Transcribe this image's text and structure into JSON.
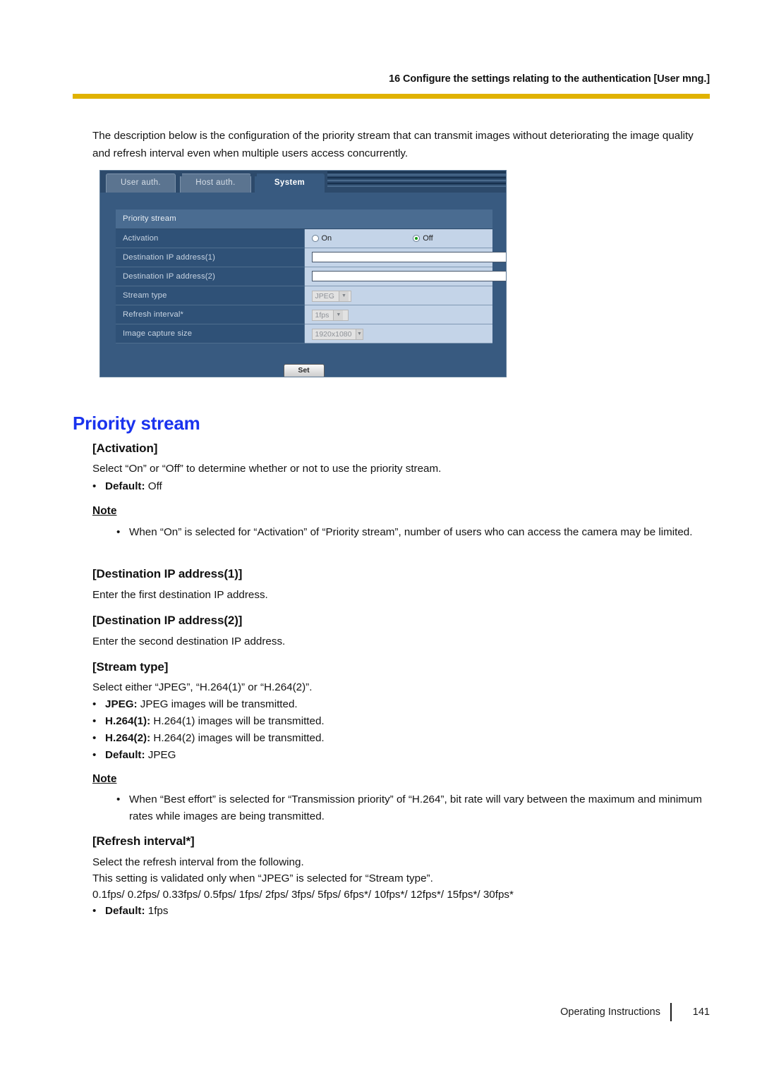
{
  "header": {
    "running_title": "16 Configure the settings relating to the authentication [User mng.]"
  },
  "intro": "The description below is the configuration of the priority stream that can transmit images without deteriorating the image quality and refresh interval even when multiple users access concurrently.",
  "screenshot": {
    "tabs": [
      {
        "label": "User auth.",
        "active": false
      },
      {
        "label": "Host auth.",
        "active": false
      },
      {
        "label": "System",
        "active": true
      }
    ],
    "section_title": "Priority stream",
    "rows": [
      {
        "label": "Activation"
      },
      {
        "label": "Destination IP address(1)"
      },
      {
        "label": "Destination IP address(2)"
      },
      {
        "label": "Stream type"
      },
      {
        "label": "Refresh interval*"
      },
      {
        "label": "Image capture size"
      }
    ],
    "activation": {
      "option_on": "On",
      "option_off": "Off",
      "selected": "Off"
    },
    "destination_ip_1_value": "",
    "destination_ip_2_value": "",
    "stream_type_value": "JPEG",
    "refresh_interval_value": "1fps",
    "image_capture_size_value": "1920x1080",
    "set_button": "Set"
  },
  "sections": {
    "priority_stream_heading": "Priority stream",
    "activation": {
      "heading": "[Activation]",
      "body": "Select “On” or “Off” to determine whether or not to use the priority stream.",
      "default_label": "Default:",
      "default_value": " Off",
      "note_title": "Note",
      "note_body": "When “On” is selected for “Activation” of “Priority stream”, number of users who can access the camera may be limited."
    },
    "dest_ip_1": {
      "heading": "[Destination IP address(1)]",
      "body": "Enter the first destination IP address."
    },
    "dest_ip_2": {
      "heading": "[Destination IP address(2)]",
      "body": "Enter the second destination IP address."
    },
    "stream_type": {
      "heading": "[Stream type]",
      "body": "Select either “JPEG”, “H.264(1)” or “H.264(2)”.",
      "bullets": [
        {
          "bold": "JPEG:",
          "rest": " JPEG images will be transmitted."
        },
        {
          "bold": "H.264(1):",
          "rest": " H.264(1) images will be transmitted."
        },
        {
          "bold": "H.264(2):",
          "rest": " H.264(2) images will be transmitted."
        },
        {
          "bold": "Default:",
          "rest": " JPEG"
        }
      ],
      "note_title": "Note",
      "note_body": "When “Best effort” is selected for “Transmission priority” of “H.264”, bit rate will vary between the maximum and minimum rates while images are being transmitted."
    },
    "refresh_interval": {
      "heading": "[Refresh interval*]",
      "body_line1": "Select the refresh interval from the following.",
      "body_line2": "This setting is validated only when “JPEG” is selected for “Stream type”.",
      "body_line3": "0.1fps/ 0.2fps/ 0.33fps/ 0.5fps/ 1fps/ 2fps/ 3fps/ 5fps/ 6fps*/ 10fps*/ 12fps*/ 15fps*/ 30fps*",
      "default_label": "Default:",
      "default_value": " 1fps"
    }
  },
  "footer": {
    "doc_title": "Operating Instructions",
    "page_number": "141"
  },
  "colors": {
    "heading_blue": "#1a33ee",
    "rule_gold": "#e0b200",
    "ui_panel_blue": "#385a80",
    "ui_field_blue": "#c4d4e8"
  },
  "bullet_glyph": "•"
}
